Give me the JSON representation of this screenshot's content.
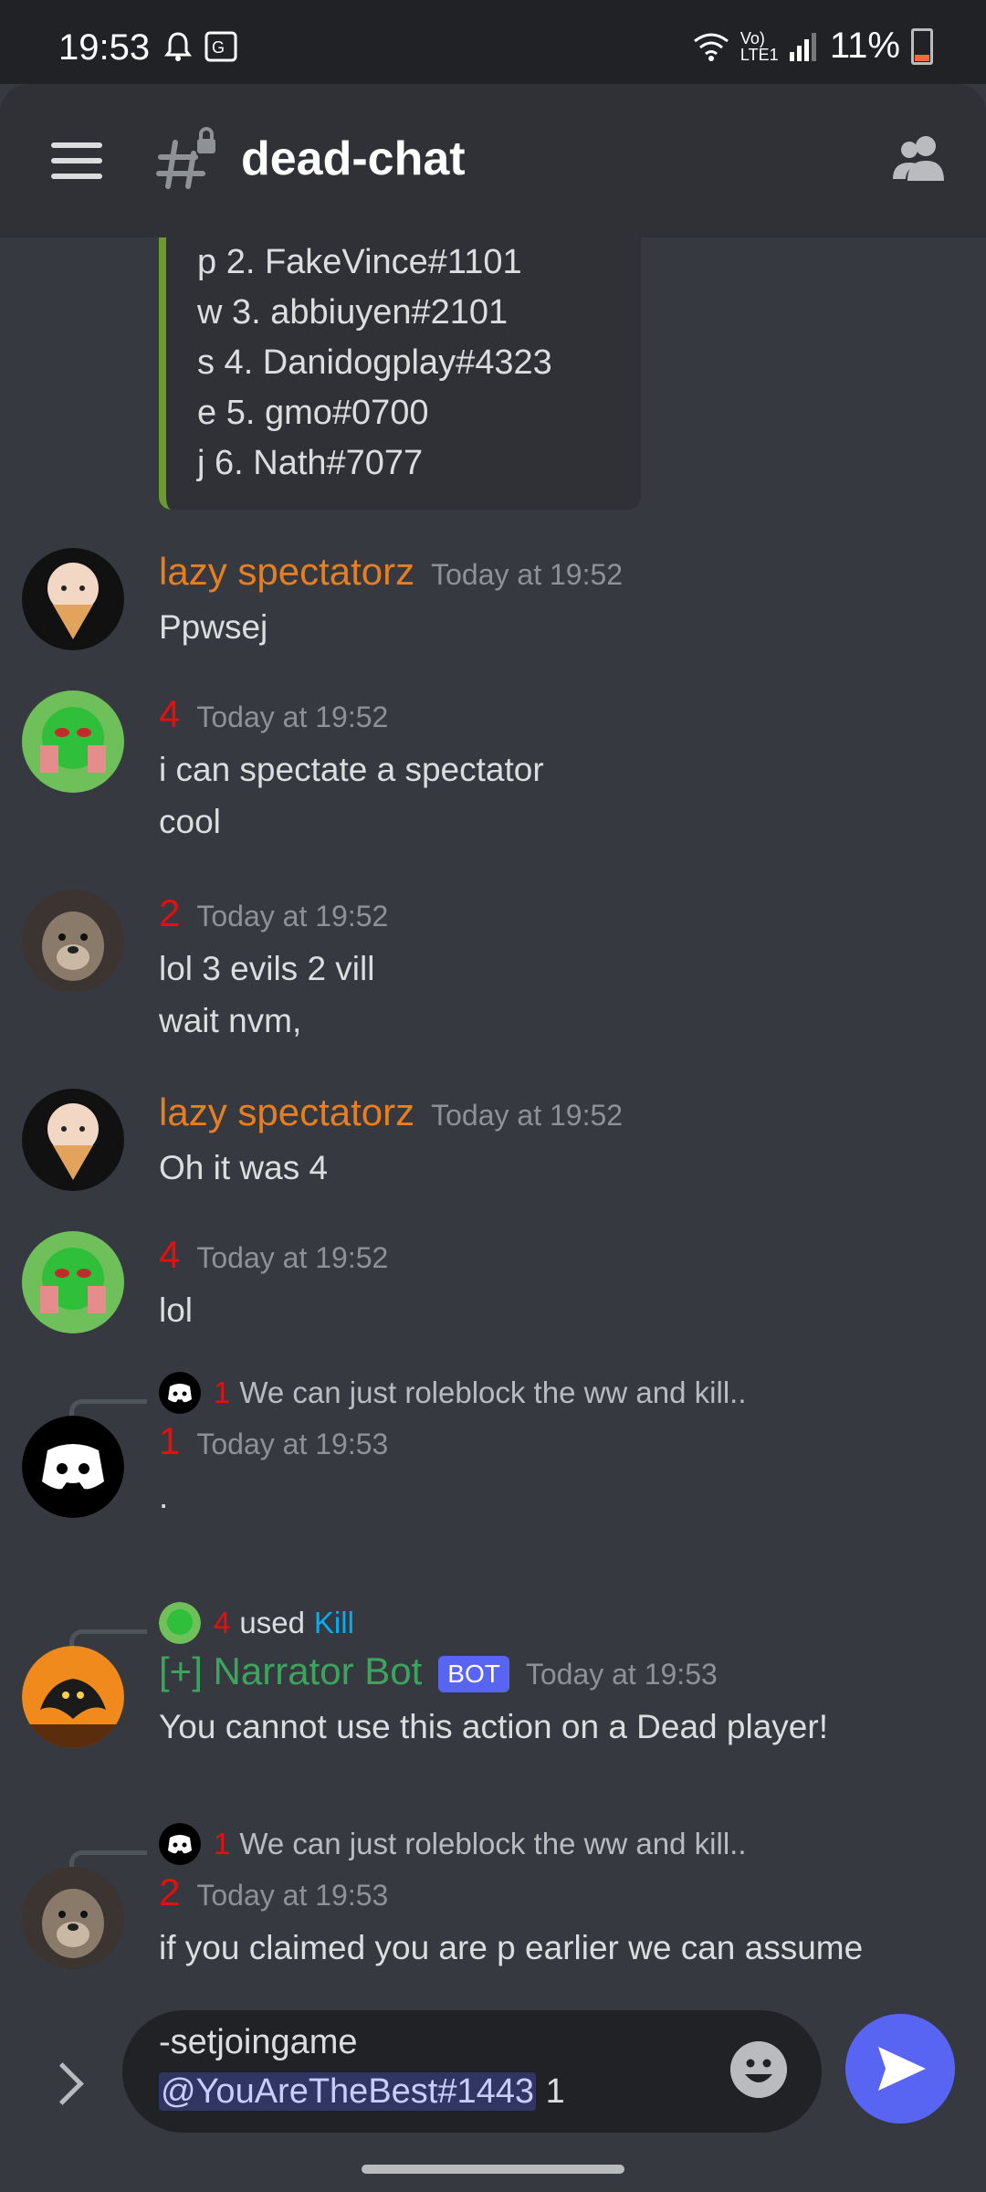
{
  "status_bar": {
    "time": "19:53",
    "battery": "11%",
    "network": "Vo) LTE1"
  },
  "header": {
    "channel": "dead-chat"
  },
  "embed": {
    "lines": [
      "p 2. FakeVince#1101",
      "w 3. abbiuyen#2101",
      "s 4. Danidogplay#4323",
      "e 5. gmo#0700",
      "j 6. Nath#7077"
    ]
  },
  "messages": [
    {
      "user": "lazy spectatorz",
      "time": "Today at 19:52",
      "lines": [
        "Ppwsej"
      ]
    },
    {
      "user": "4",
      "time": "Today at 19:52",
      "lines": [
        "i can spectate a spectator",
        "cool"
      ]
    },
    {
      "user": "2",
      "time": "Today at 19:52",
      "lines": [
        "lol 3 evils 2 vill",
        "wait nvm,"
      ]
    },
    {
      "user": "lazy spectatorz",
      "time": "Today at 19:52",
      "lines": [
        "Oh it was 4"
      ]
    },
    {
      "user": "4",
      "time": "Today at 19:52",
      "lines": [
        "lol"
      ]
    },
    {
      "reply_user": "1",
      "reply_text": "We can just roleblock the ww and kill..",
      "user": "1",
      "time": "Today at 19:53",
      "lines": [
        "."
      ]
    },
    {
      "reply_user": "4",
      "reply_used": "used",
      "reply_cmd": "Kill",
      "user": "[+] Narrator Bot",
      "badge": "BOT",
      "time": "Today at 19:53",
      "lines": [
        "You cannot use this action on a Dead player!"
      ]
    },
    {
      "reply_user": "1",
      "reply_text": "We can just roleblock the ww and kill..",
      "user": "2",
      "time": "Today at 19:53",
      "lines": [
        "if you claimed you are p earlier we can assume"
      ]
    }
  ],
  "composer": {
    "line1": "-setjoingame",
    "mention": "@YouAreTheBest#1443",
    "suffix": " 1"
  },
  "colors": {
    "accent": "#5865f2",
    "spectator": "#e67e22",
    "number_user": "#e50f0f",
    "bot_green": "#3ba55d"
  }
}
